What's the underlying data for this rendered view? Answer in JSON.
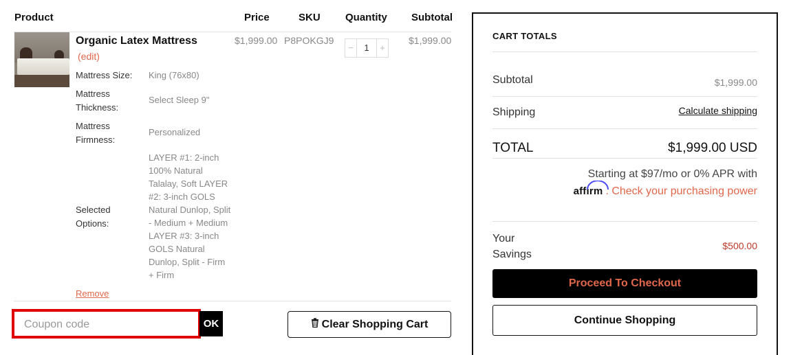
{
  "table": {
    "headers": {
      "product": "Product",
      "price": "Price",
      "sku": "SKU",
      "quantity": "Quantity",
      "subtotal": "Subtotal"
    }
  },
  "item": {
    "name": "Organic Latex Mattress",
    "edit_label": "(edit)",
    "price": "$1,999.00",
    "sku": "P8POKGJ9",
    "quantity": "1",
    "qty_minus": "−",
    "qty_plus": "+",
    "subtotal": "$1,999.00",
    "remove_label": "Remove",
    "options": {
      "size_label": "Mattress Size:",
      "size_value": "King (76x80)",
      "thickness_label": "Mattress Thickness:",
      "thickness_value": "Select Sleep 9\"",
      "firmness_label": "Mattress Firmness:",
      "firmness_value": "Personalized",
      "selected_label": "Selected Options:",
      "selected_value": "LAYER #1: 2-inch 100% Natural Talalay, Soft LAYER #2: 3-inch GOLS Natural Dunlop, Split - Medium + Medium LAYER #3: 3-inch GOLS Natural Dunlop, Split - Firm + Firm"
    }
  },
  "coupon": {
    "placeholder": "Coupon code",
    "apply_label": "OK"
  },
  "clear_cart": {
    "icon": "trash-icon",
    "label": "Clear Shopping Cart"
  },
  "totals": {
    "title": "CART TOTALS",
    "subtotal_label": "Subtotal",
    "subtotal_value": "$1,999.00",
    "shipping_label": "Shipping",
    "shipping_link": "Calculate shipping",
    "total_label": "TOTAL",
    "total_value": "$1,999.00 USD",
    "affirm_text": "Starting at $97/mo or 0% APR with",
    "affirm_logo": "affirm",
    "affirm_link": ". Check your purchasing power",
    "savings_label": "Your Savings",
    "savings_value": "$500.00",
    "checkout_label": "Proceed To Checkout",
    "continue_label": "Continue Shopping"
  },
  "colors": {
    "accent": "#e0674a",
    "coupon_highlight": "#e10000",
    "savings": "#c0392b"
  }
}
